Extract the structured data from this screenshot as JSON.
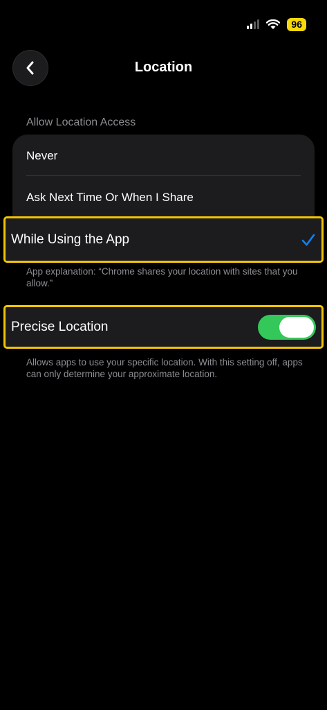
{
  "status_bar": {
    "battery": "96"
  },
  "header": {
    "title": "Location"
  },
  "section": {
    "label": "Allow Location Access"
  },
  "options": {
    "never": "Never",
    "ask_next": "Ask Next Time Or When I Share",
    "while_using": "While Using the App"
  },
  "app_explanation": "App explanation: “Chrome shares your location with sites that you allow.”",
  "precise": {
    "label": "Precise Location",
    "enabled": true,
    "description": "Allows apps to use your specific location. With this setting off, apps can only determine your approximate location."
  },
  "colors": {
    "accent_check": "#0a84ff",
    "toggle_on": "#34c759",
    "highlight": "#f3c500"
  }
}
